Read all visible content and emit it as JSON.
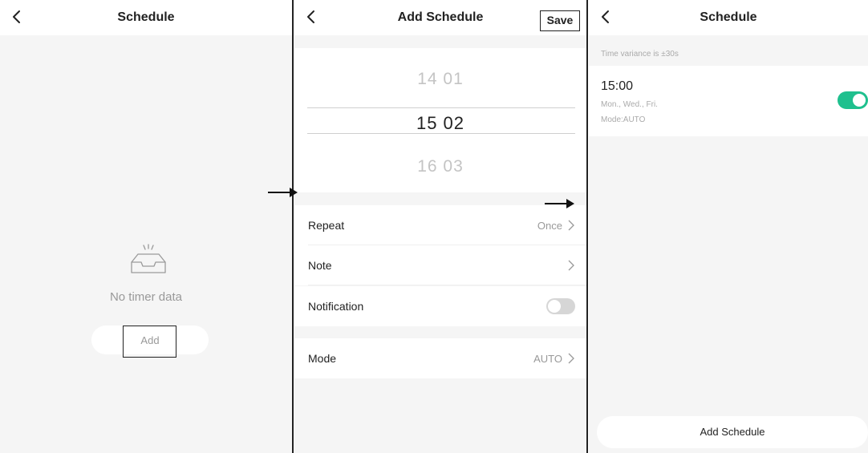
{
  "screen1": {
    "title": "Schedule",
    "empty_text": "No timer data",
    "add_label": "Add"
  },
  "screen2": {
    "title": "Add Schedule",
    "save_label": "Save",
    "picker": {
      "prev": "14 01",
      "selected": "15 02",
      "next": "16 03"
    },
    "rows": {
      "repeat": {
        "label": "Repeat",
        "value": "Once"
      },
      "note": {
        "label": "Note",
        "value": ""
      },
      "notification": {
        "label": "Notification",
        "enabled": false
      },
      "mode": {
        "label": "Mode",
        "value": "AUTO"
      }
    }
  },
  "screen3": {
    "title": "Schedule",
    "variance_text": "Time variance is ±30s",
    "item": {
      "time": "15:00",
      "days": "Mon., Wed., Fri.",
      "mode": "Mode:AUTO",
      "enabled": true
    },
    "add_button": "Add Schedule"
  },
  "icons": {
    "back": "chevron-left-icon",
    "empty": "empty-inbox-icon",
    "chevron": "chevron-right-icon",
    "arrow": "arrow-right-icon"
  },
  "colors": {
    "accent": "#1fc08e",
    "background": "#f5f5f5",
    "card": "#ffffff",
    "muted": "#999999"
  }
}
